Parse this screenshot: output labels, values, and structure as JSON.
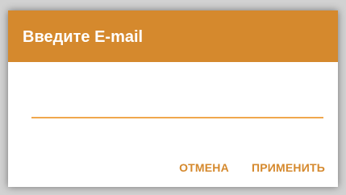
{
  "dialog": {
    "title": "Введите E-mail",
    "email_input": {
      "value": "",
      "placeholder": ""
    },
    "buttons": {
      "cancel_label": "ОТМЕНА",
      "apply_label": "ПРИМЕНИТЬ"
    }
  },
  "colors": {
    "accent": "#d5892d",
    "underline": "#f0a84e",
    "title_text": "#ffffff",
    "dialog_background": "#ffffff"
  }
}
